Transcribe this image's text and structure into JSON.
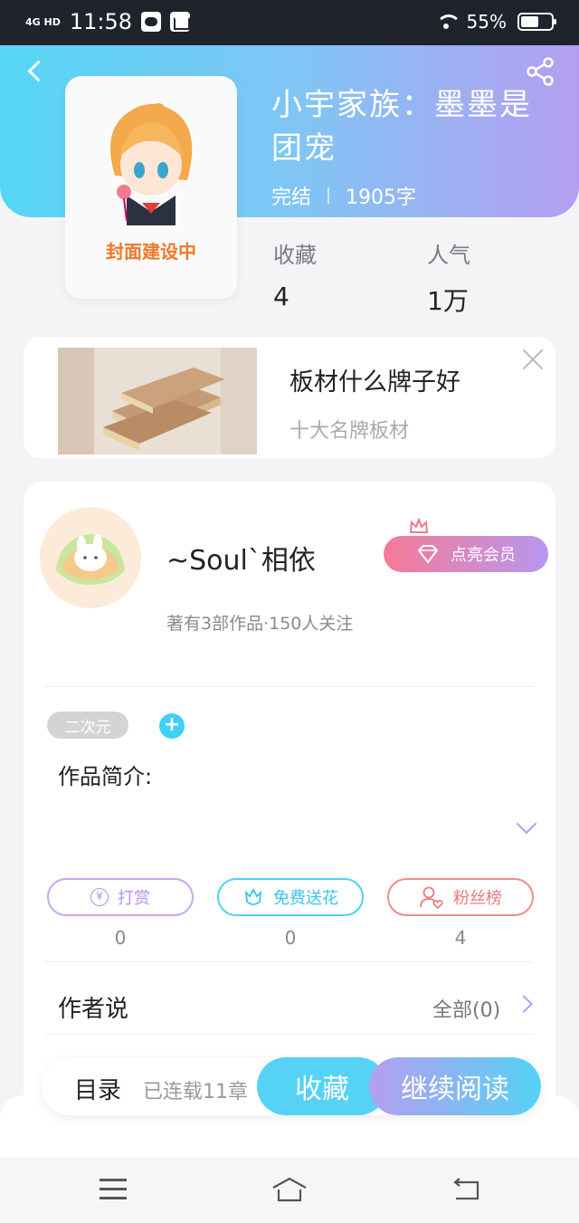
{
  "status_bar": {
    "network": "4G HD",
    "time": "11:58",
    "battery": "55%"
  },
  "book": {
    "cover_label": "封面建设中",
    "title": "小宇家族：墨墨是团宠",
    "status": "完结",
    "word_count": "1905字",
    "stats": [
      {
        "label": "收藏",
        "value": "4"
      },
      {
        "label": "人气",
        "value": "1万"
      }
    ]
  },
  "ad": {
    "title": "板材什么牌子好",
    "subtitle": "十大名牌板材"
  },
  "author": {
    "name": "~Soul`相依",
    "stats": "著有3部作品·150人关注",
    "vip_label": "点亮会员"
  },
  "tag": "二次元",
  "tag_add": "+",
  "intro_label": "作品简介:",
  "actions": [
    {
      "label": "打赏",
      "icon": "yen-icon",
      "count": "0"
    },
    {
      "label": "免费送花",
      "icon": "flower-icon",
      "count": "0"
    },
    {
      "label": "粉丝榜",
      "icon": "fans-icon",
      "count": "4"
    }
  ],
  "yen_symbol": "¥",
  "author_says": {
    "label": "作者说",
    "all": "全部(0)"
  },
  "bottom_bar": {
    "toc_label": "目录",
    "toc_status": "已连载11章",
    "favorite": "收藏",
    "continue": "继续阅读"
  },
  "colors": {
    "header_start": "#55d6f5",
    "header_end": "#b59ef0",
    "accent_blue": "#55d2f5",
    "accent_purple": "#b59ef0"
  }
}
